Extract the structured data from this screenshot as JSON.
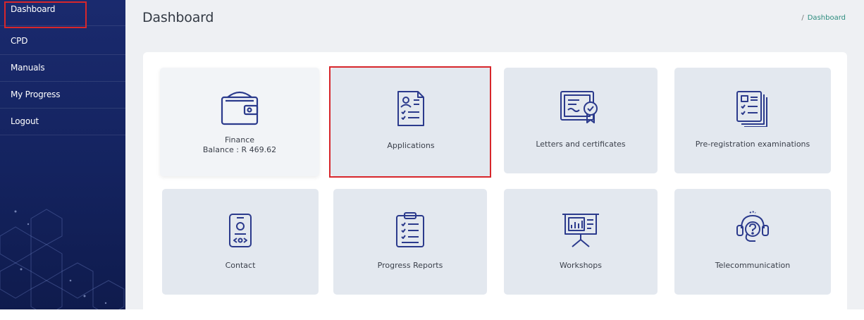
{
  "sidebar": {
    "items": [
      {
        "label": "Dashboard",
        "active": true
      },
      {
        "label": "CPD"
      },
      {
        "label": "Manuals"
      },
      {
        "label": "My Progress"
      },
      {
        "label": "Logout"
      }
    ]
  },
  "header": {
    "title": "Dashboard",
    "breadcrumb": {
      "separator": "/",
      "current": "Dashboard"
    }
  },
  "tiles": [
    {
      "icon": "wallet-icon",
      "label": "Finance",
      "sublabel": "Balance : R 469.62"
    },
    {
      "icon": "application-form-icon",
      "label": "Applications"
    },
    {
      "icon": "certificate-icon",
      "label": "Letters and certificates"
    },
    {
      "icon": "exam-papers-icon",
      "label": "Pre-registration examinations"
    },
    {
      "icon": "contact-card-icon",
      "label": "Contact"
    },
    {
      "icon": "clipboard-report-icon",
      "label": "Progress Reports"
    },
    {
      "icon": "presentation-board-icon",
      "label": "Workshops"
    },
    {
      "icon": "headset-icon",
      "label": "Telecommunication"
    }
  ],
  "colors": {
    "sidebar": "#14235f",
    "content_bg": "#eef0f3",
    "tile_bg": "#e3e8ef",
    "icon_stroke": "#2b3a8c",
    "highlight": "#d7262b",
    "breadcrumb": "#2c8c7e"
  }
}
